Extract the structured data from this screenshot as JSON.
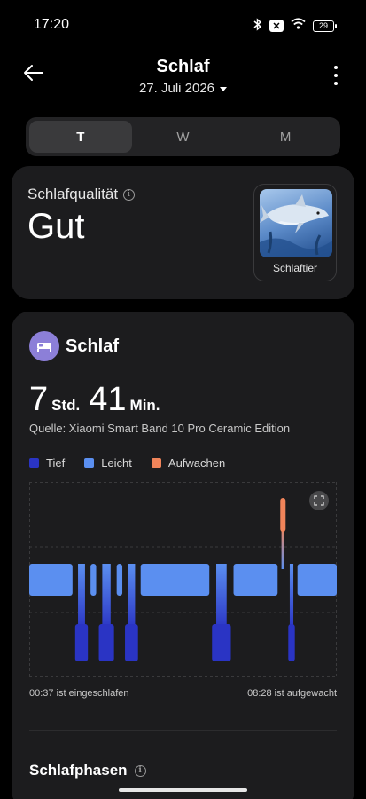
{
  "status_bar": {
    "time": "17:20",
    "battery": "29"
  },
  "header": {
    "title": "Schlaf",
    "date": "27. Juli 2026"
  },
  "tabs": [
    {
      "label": "T",
      "active": true
    },
    {
      "label": "W",
      "active": false
    },
    {
      "label": "M",
      "active": false
    }
  ],
  "quality": {
    "label": "Schlafqualität",
    "value": "Gut",
    "animal_label": "Schlaftier"
  },
  "sleep": {
    "title": "Schlaf",
    "hours": "7",
    "hours_unit": "Std.",
    "minutes": "41",
    "minutes_unit": "Min.",
    "source": "Quelle: Xiaomi Smart Band 10 Pro Ceramic Edition",
    "start_label": "00:37 ist eingeschlafen",
    "end_label": "08:28 ist aufgewacht",
    "phases_title": "Schlafphasen"
  },
  "colors": {
    "deep": "#2a34c4",
    "light": "#5b8ff0",
    "awake": "#f0845a",
    "accent": "#8c7fd8"
  },
  "chart_data": {
    "type": "hypnogram",
    "legend": [
      "Tief",
      "Leicht",
      "Aufwachen"
    ],
    "x_start": "00:37",
    "x_end": "08:28",
    "segments": [
      {
        "stage": "Leicht",
        "start": 0.0,
        "end": 0.145
      },
      {
        "stage": "Tief",
        "start": 0.145,
        "end": 0.195
      },
      {
        "stage": "Leicht",
        "start": 0.195,
        "end": 0.222
      },
      {
        "stage": "Tief",
        "start": 0.222,
        "end": 0.28
      },
      {
        "stage": "Leicht",
        "start": 0.28,
        "end": 0.307
      },
      {
        "stage": "Tief",
        "start": 0.307,
        "end": 0.358
      },
      {
        "stage": "Leicht",
        "start": 0.358,
        "end": 0.59
      },
      {
        "stage": "Tief",
        "start": 0.59,
        "end": 0.66
      },
      {
        "stage": "Leicht",
        "start": 0.66,
        "end": 0.812
      },
      {
        "stage": "Aufwachen",
        "start": 0.812,
        "end": 0.838
      },
      {
        "stage": "Tief",
        "start": 0.838,
        "end": 0.868
      },
      {
        "stage": "Leicht",
        "start": 0.868,
        "end": 1.0
      }
    ]
  },
  "icons": {
    "back": "arrow-left-icon",
    "more": "more-vertical-icon",
    "info": "info-icon",
    "sleep": "bed-icon",
    "expand": "expand-icon"
  }
}
